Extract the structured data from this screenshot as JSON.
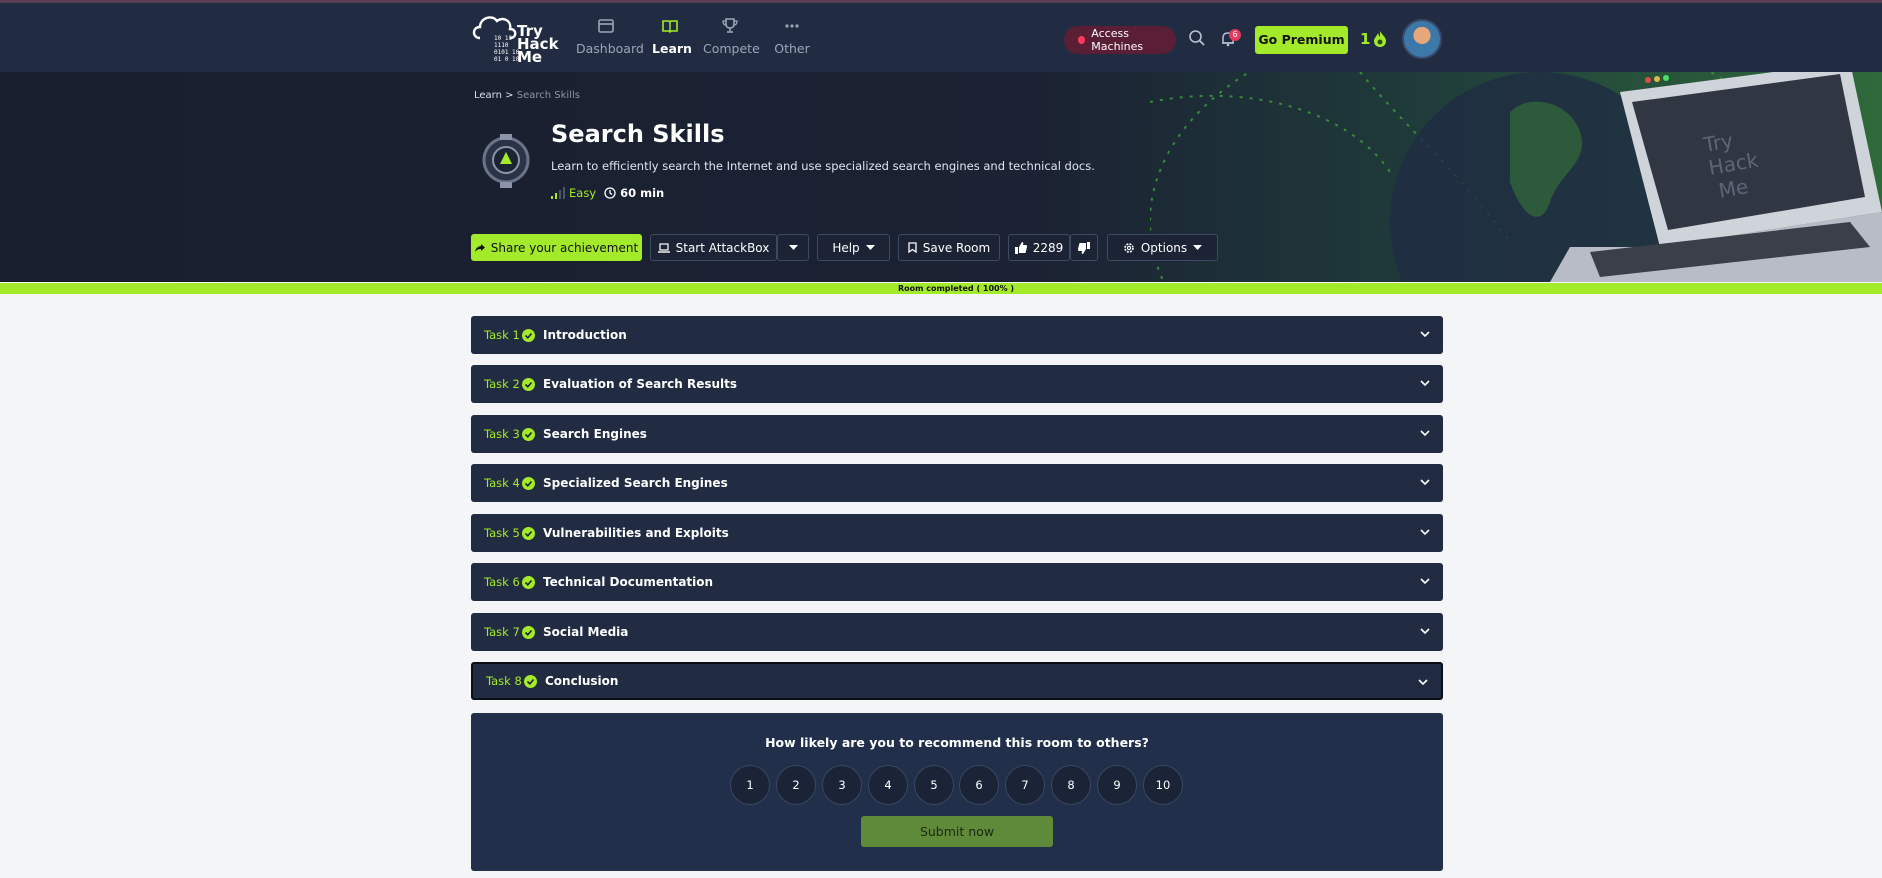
{
  "nav": {
    "brand_lines": [
      "Try",
      "Hack",
      "Me"
    ],
    "brand_binary": [
      "10 10",
      "1110",
      "0101 10",
      "01 0 10"
    ],
    "items": [
      {
        "label": "Dashboard",
        "icon": "dashboard-icon",
        "active": false
      },
      {
        "label": "Learn",
        "icon": "book-icon",
        "active": true
      },
      {
        "label": "Compete",
        "icon": "trophy-icon",
        "active": false
      },
      {
        "label": "Other",
        "icon": "more-icon",
        "active": false
      }
    ],
    "access_machines": "Access Machines",
    "notification_count": "6",
    "go_premium": "Go Premium",
    "streak": "1"
  },
  "breadcrumb": {
    "parent": "Learn",
    "separator": ">",
    "current": "Search Skills"
  },
  "room": {
    "title": "Search Skills",
    "description": "Learn to efficiently search the Internet and use specialized search engines and technical docs.",
    "difficulty": "Easy",
    "duration": "60 min"
  },
  "actions": {
    "share": "Share your achievement",
    "attackbox": "Start AttackBox",
    "help": "Help",
    "save": "Save Room",
    "likes": "2289",
    "options": "Options"
  },
  "progress": {
    "label": "Room completed ( 100% )",
    "value": 1.0
  },
  "tasks": [
    {
      "number": "Task 1",
      "title": "Introduction"
    },
    {
      "number": "Task 2",
      "title": "Evaluation of Search Results"
    },
    {
      "number": "Task 3",
      "title": "Search Engines"
    },
    {
      "number": "Task 4",
      "title": "Specialized Search Engines"
    },
    {
      "number": "Task 5",
      "title": "Vulnerabilities and Exploits"
    },
    {
      "number": "Task 6",
      "title": "Technical Documentation"
    },
    {
      "number": "Task 7",
      "title": "Social Media"
    },
    {
      "number": "Task 8",
      "title": "Conclusion"
    }
  ],
  "feedback": {
    "question": "How likely are you to recommend this room to others?",
    "ratings": [
      "1",
      "2",
      "3",
      "4",
      "5",
      "6",
      "7",
      "8",
      "9",
      "10"
    ],
    "submit": "Submit now"
  },
  "colors": {
    "accent": "#a3ea2a",
    "nav_bg": "#212c42",
    "task_bg": "#212c42",
    "danger": "#e63a5c"
  }
}
